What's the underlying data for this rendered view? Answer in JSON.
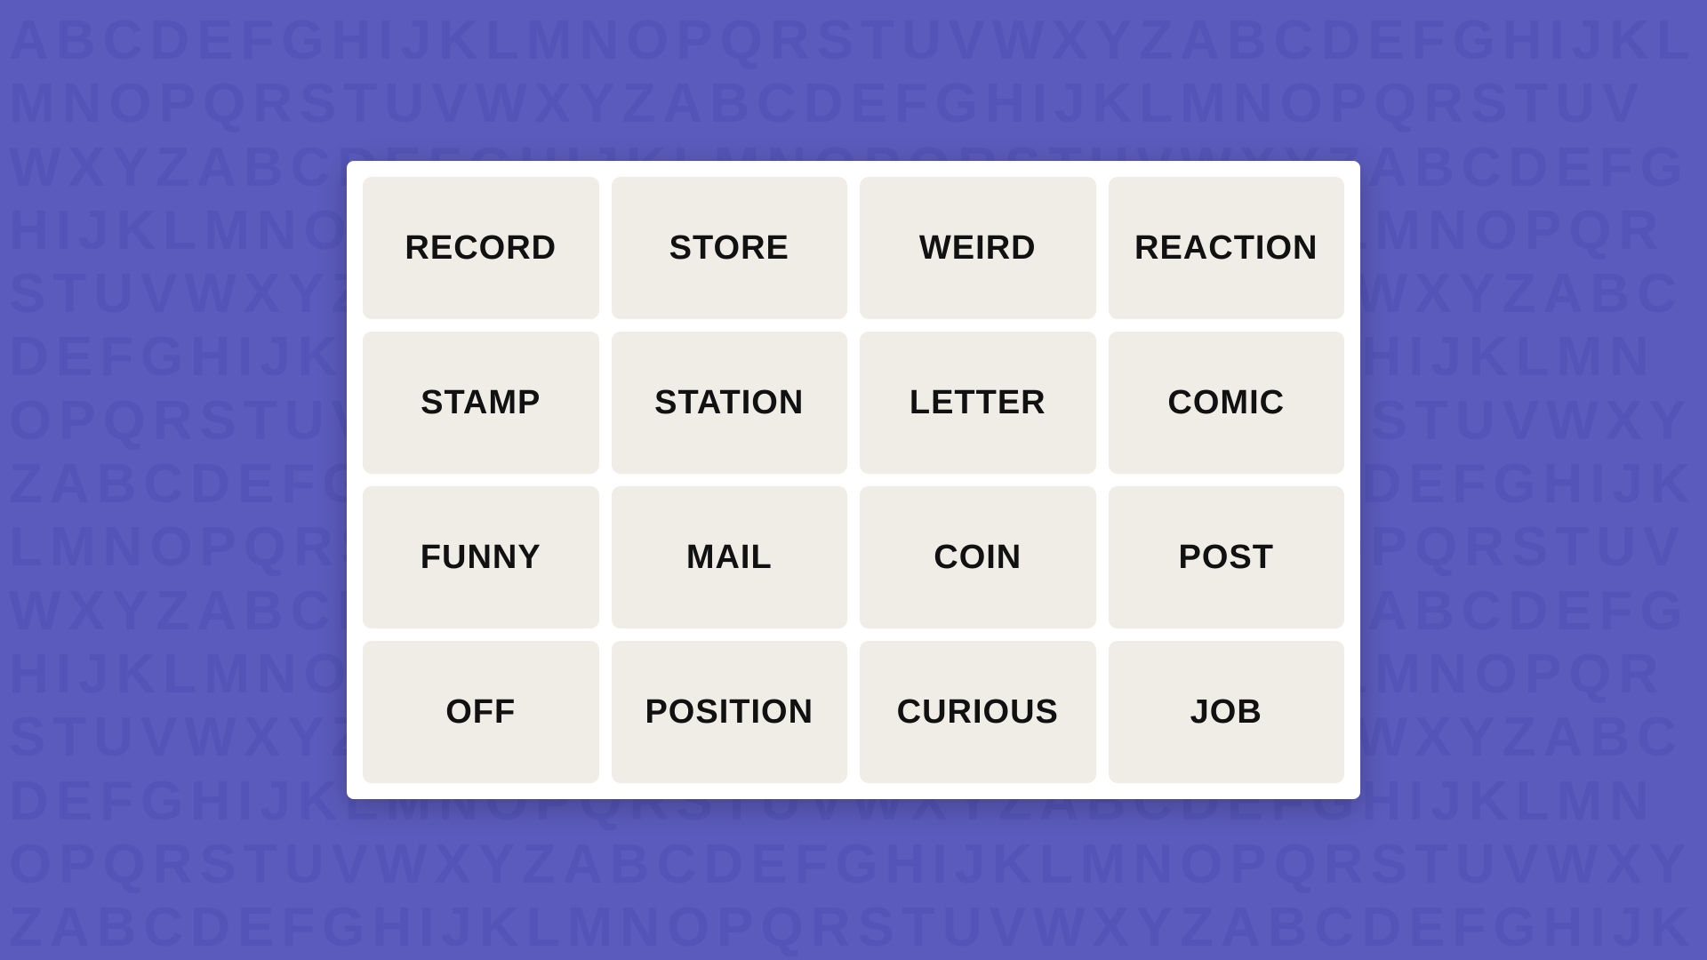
{
  "background": {
    "letters": "ABCDEFGHIJKLMNOPQRSTUVWXYZABCDEFGHIJKLMNOPQRSTUVWXYZABCDEFGHIJKLMNOPQRSTUVWXYZABCDEFGHIJKLMNOPQRSTUVWXYZABCDEFGHIJKLMNOPQRSTUVWXYZABCDEFGHIJKLMNOPQRSTUVWXYZABCDEFGHIJKLMNOPQRSTUVWXYZABCDEFGHIJKLMNOPQRSTUVWXYZABCDEFGHIJKLMNOPQRSTUVWXYZABCDEFGHIJKLMNOPQRSTUVWXYZABCDEFGHIJKLMNOPQRSTUVWXYZABCDEFGHIJKLMNOPQRSTUVWXYZABCDEFGHIJKLMNOPQRSTUVWXYZABCDEFGHIJKLMNOPQRSTUVWXYZABCDEFGHIJKLMNOPQRSTUVWXYZ"
  },
  "grid": {
    "words": [
      {
        "id": "record",
        "label": "RECORD"
      },
      {
        "id": "store",
        "label": "STORE"
      },
      {
        "id": "weird",
        "label": "WEIRD"
      },
      {
        "id": "reaction",
        "label": "REACTION"
      },
      {
        "id": "stamp",
        "label": "STAMP"
      },
      {
        "id": "station",
        "label": "STATION"
      },
      {
        "id": "letter",
        "label": "LETTER"
      },
      {
        "id": "comic",
        "label": "COMIC"
      },
      {
        "id": "funny",
        "label": "FUNNY"
      },
      {
        "id": "mail",
        "label": "MAIL"
      },
      {
        "id": "coin",
        "label": "COIN"
      },
      {
        "id": "post",
        "label": "POST"
      },
      {
        "id": "off",
        "label": "OFF"
      },
      {
        "id": "position",
        "label": "POSITION"
      },
      {
        "id": "curious",
        "label": "CURIOUS"
      },
      {
        "id": "job",
        "label": "JOB"
      }
    ]
  }
}
